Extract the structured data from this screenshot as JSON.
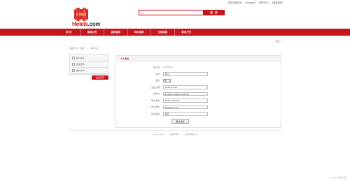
{
  "toplinks": {
    "welcome": "欢迎光临本站!",
    "username": "zhangsan",
    "user_center": "[用户中心]",
    "logout": "[退出登录]"
  },
  "logo": {
    "text_main": "Hotels",
    "text_suffix": ".com"
  },
  "search": {
    "placeholder": "",
    "button": "搜 索"
  },
  "nav": [
    "首 页",
    "新闻公告",
    "酒店客房",
    "特价客房",
    "全部商品",
    "联系方式"
  ],
  "logout_link": "[退出]",
  "breadcrumb": [
    "当前位置:",
    "首页",
    ">",
    "用户中心"
  ],
  "sidebar": {
    "items": [
      {
        "label": "用户信息",
        "arrow": "›"
      },
      {
        "label": "修改密码",
        "arrow": "›"
      },
      {
        "label": "我的订单",
        "arrow": "›"
      }
    ],
    "red_button": "退出登录"
  },
  "profile": {
    "title": "个人资料",
    "fields": [
      {
        "label": "用户名:",
        "value": "zhangsan"
      },
      {
        "label": "姓名:",
        "value": "张三"
      },
      {
        "label": "性别:",
        "value": "男"
      },
      {
        "label": "出生日期:",
        "value": "1992-03-09"
      },
      {
        "label": "身份证:",
        "value": "420982199210142356"
      },
      {
        "label": "联系电话:",
        "value": "13777777777"
      },
      {
        "label": "电子邮件:",
        "value": "aaa@qq.com"
      },
      {
        "label": "联系地址:",
        "value": "北京"
      }
    ],
    "confirm_button": "确认修改"
  },
  "footer": {
    "copyright": "Copyright",
    "site": "酒店管理",
    "admin": "后台管理入口"
  },
  "watermark": "CSDN @毕业设计",
  "colors": {
    "brand_red": "#c8161d"
  }
}
